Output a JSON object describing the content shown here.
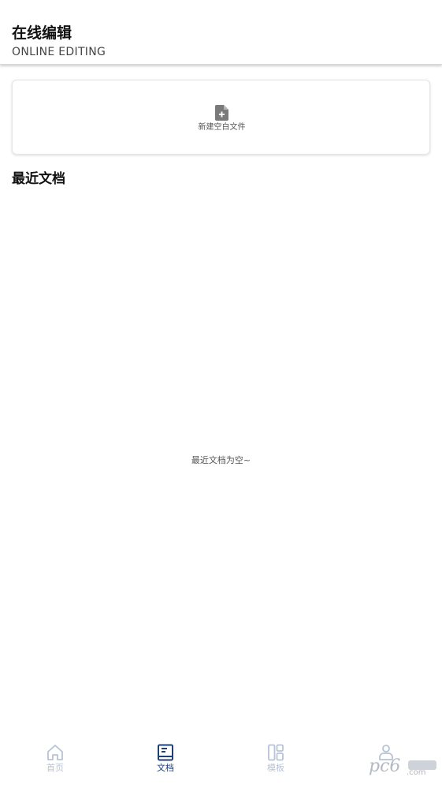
{
  "header": {
    "title": "在线编辑",
    "subtitle": "ONLINE EDITING"
  },
  "new_file": {
    "label": "新建空白文件",
    "icon": "file-add-icon"
  },
  "recent": {
    "title": "最近文档",
    "empty_message": "最近文档为空~"
  },
  "tabbar": {
    "tabs": [
      {
        "label": "首页",
        "icon": "home-icon",
        "active": false
      },
      {
        "label": "文档",
        "icon": "book-icon",
        "active": true
      },
      {
        "label": "模板",
        "icon": "template-icon",
        "active": false
      },
      {
        "label": "",
        "icon": "profile-icon",
        "active": false
      }
    ]
  },
  "watermark": {
    "text": "pc6",
    "suffix": ".com"
  },
  "colors": {
    "active_tab": "#1f3f7a",
    "inactive_tab": "#b7c3d6",
    "header_divider": "#d8d8d8"
  }
}
